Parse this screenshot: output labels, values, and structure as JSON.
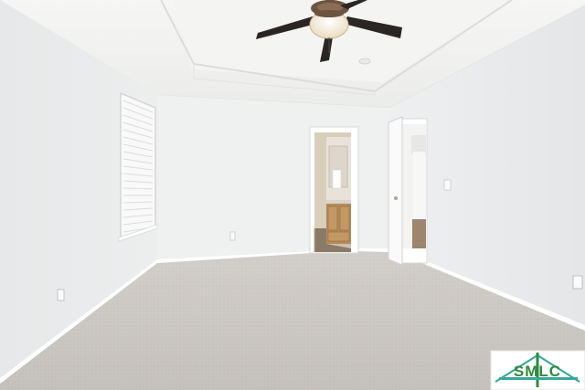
{
  "photo": {
    "subject": "empty-room-interior"
  },
  "watermark": {
    "brand": "SMLC",
    "tagline": "",
    "colors": {
      "green": "#2f8a3e",
      "teal": "#3aa89c",
      "background": "#ffffff"
    }
  },
  "colors": {
    "wall_left": "#e9ebec",
    "wall_back": "#f0f1f1",
    "wall_right": "#eeefef",
    "ceiling": "#f2f2f1",
    "carpet": "#cbc7c2",
    "baseboard": "#ffffff",
    "fan_blade": "#2b2523",
    "fan_light": "#f6ecd8",
    "wood_cabinet": "#b58a57",
    "bath_floor": "#8b7a67"
  }
}
